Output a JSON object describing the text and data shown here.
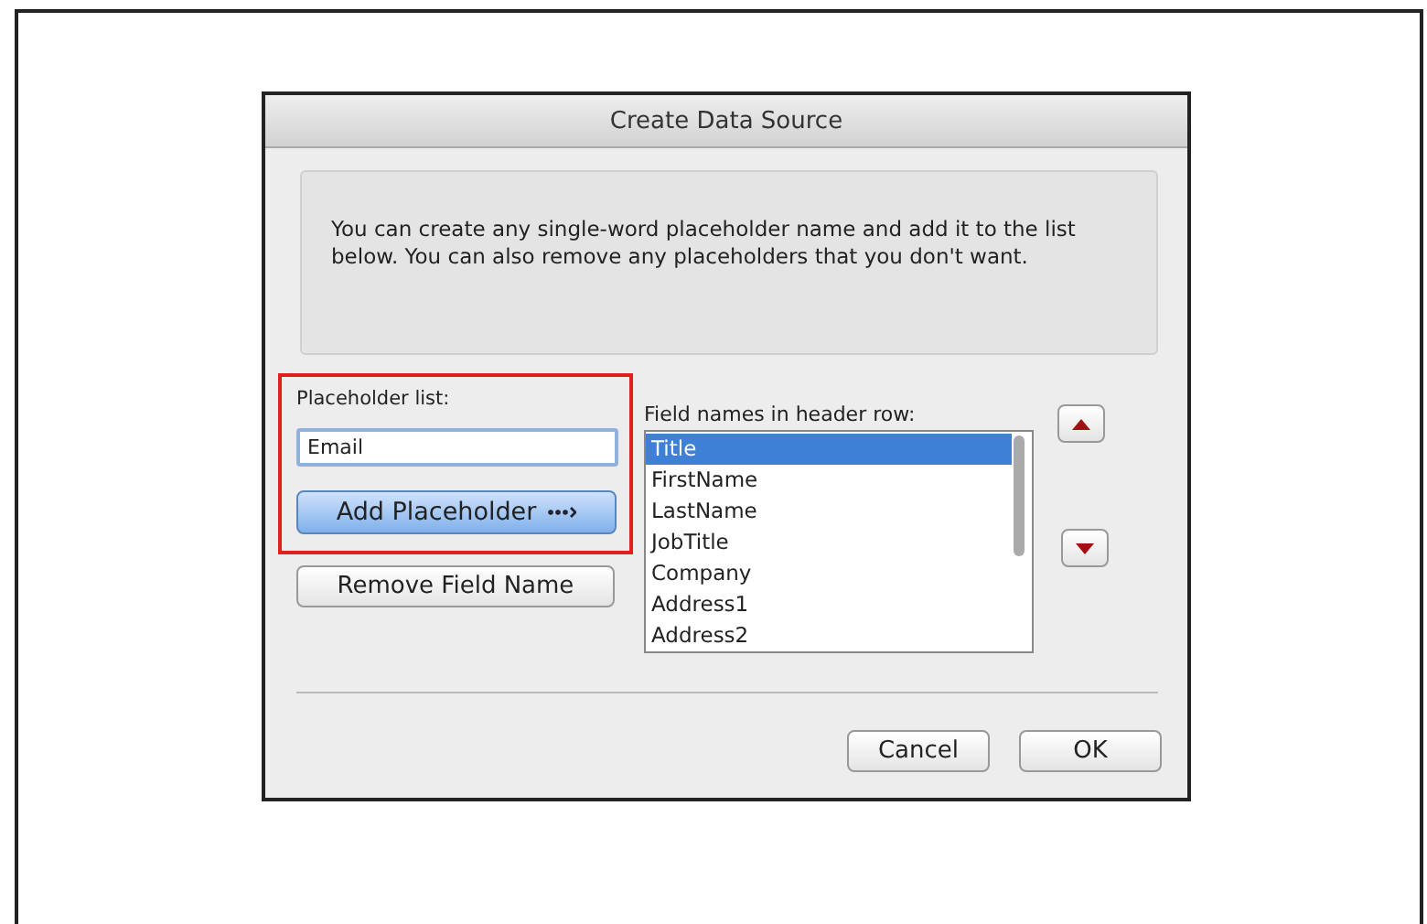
{
  "window": {
    "title": "Create Data Source"
  },
  "message": "You can create any single-word placeholder name and add it to the list below.  You can also remove any placeholders that you don't want.",
  "placeholder_panel": {
    "highlighted": true,
    "label": "Placeholder list:",
    "value": "Email",
    "add_button": "Add Placeholder"
  },
  "remove_button": "Remove Field Name",
  "field_list": {
    "label": "Field names in header row:",
    "items": [
      {
        "text": "Title",
        "selected": true
      },
      {
        "text": "FirstName",
        "selected": false
      },
      {
        "text": "LastName",
        "selected": false
      },
      {
        "text": "JobTitle",
        "selected": false
      },
      {
        "text": "Company",
        "selected": false
      },
      {
        "text": "Address1",
        "selected": false
      },
      {
        "text": "Address2",
        "selected": false
      }
    ]
  },
  "buttons": [
    {
      "label": "Cancel",
      "default": false
    },
    {
      "label": "OK",
      "default": false
    }
  ]
}
